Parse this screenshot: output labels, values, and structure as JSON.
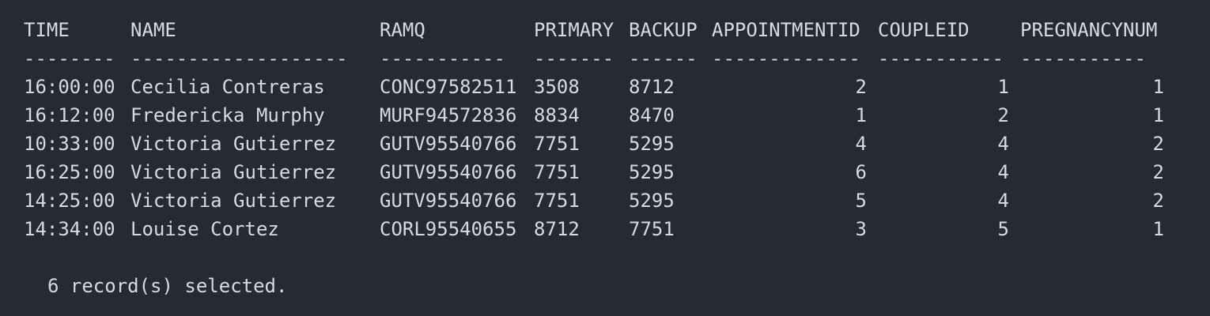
{
  "columns": [
    {
      "key": "time",
      "label": "TIME",
      "dashes": "--------"
    },
    {
      "key": "name",
      "label": "NAME",
      "dashes": "-------------------"
    },
    {
      "key": "ramq",
      "label": "RAMQ",
      "dashes": "-----------"
    },
    {
      "key": "primary",
      "label": "PRIMARY",
      "dashes": "-------"
    },
    {
      "key": "backup",
      "label": "BACKUP",
      "dashes": "------"
    },
    {
      "key": "appointmentid",
      "label": "APPOINTMENTID",
      "dashes": "-------------"
    },
    {
      "key": "coupleid",
      "label": "COUPLEID",
      "dashes": "-----------"
    },
    {
      "key": "pregnancynum",
      "label": "PREGNANCYNUM",
      "dashes": "-----------"
    }
  ],
  "rows": [
    {
      "time": "16:00:00",
      "name": "Cecilia Contreras",
      "ramq": "CONC97582511",
      "primary": "3508",
      "backup": "8712",
      "appointmentid": "2",
      "coupleid": "1",
      "pregnancynum": "1"
    },
    {
      "time": "16:12:00",
      "name": "Fredericka Murphy",
      "ramq": "MURF94572836",
      "primary": "8834",
      "backup": "8470",
      "appointmentid": "1",
      "coupleid": "2",
      "pregnancynum": "1"
    },
    {
      "time": "10:33:00",
      "name": "Victoria Gutierrez",
      "ramq": "GUTV95540766",
      "primary": "7751",
      "backup": "5295",
      "appointmentid": "4",
      "coupleid": "4",
      "pregnancynum": "2"
    },
    {
      "time": "16:25:00",
      "name": "Victoria Gutierrez",
      "ramq": "GUTV95540766",
      "primary": "7751",
      "backup": "5295",
      "appointmentid": "6",
      "coupleid": "4",
      "pregnancynum": "2"
    },
    {
      "time": "14:25:00",
      "name": "Victoria Gutierrez",
      "ramq": "GUTV95540766",
      "primary": "7751",
      "backup": "5295",
      "appointmentid": "5",
      "coupleid": "4",
      "pregnancynum": "2"
    },
    {
      "time": "14:34:00",
      "name": "Louise Cortez",
      "ramq": "CORL95540655",
      "primary": "8712",
      "backup": "7751",
      "appointmentid": "3",
      "coupleid": "5",
      "pregnancynum": "1"
    }
  ],
  "footer": "6 record(s) selected.",
  "colors": {
    "background": "#262a33",
    "text": "#d7dae0"
  }
}
